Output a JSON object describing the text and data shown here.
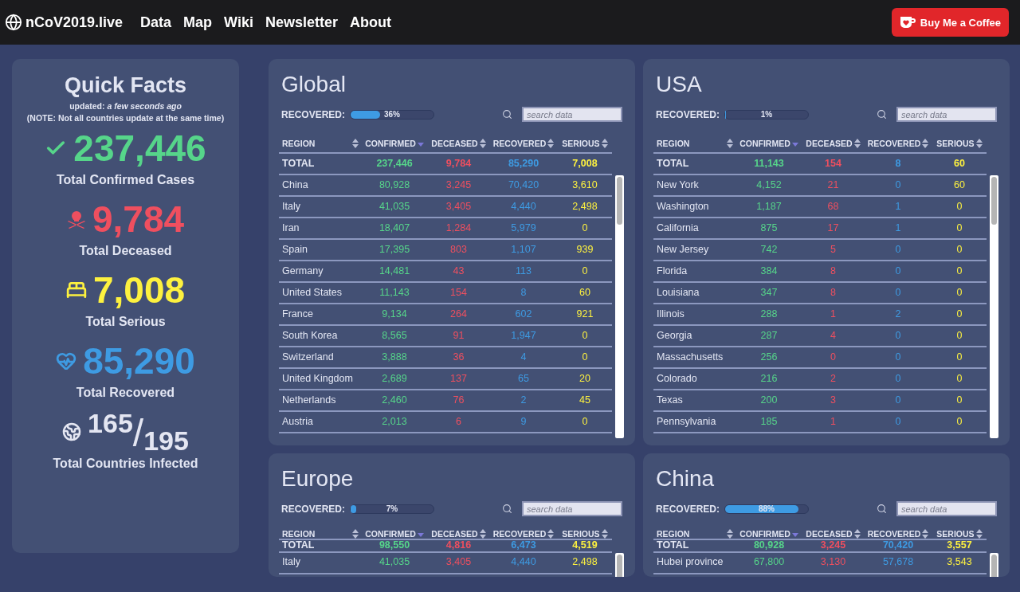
{
  "nav": {
    "brand": "nCoV2019.live",
    "links": [
      "Data",
      "Map",
      "Wiki",
      "Newsletter",
      "About"
    ],
    "donate_button": "Buy Me a Coffee"
  },
  "quick_facts": {
    "title": "Quick Facts",
    "updated_label": "updated:",
    "updated_value": "a few seconds ago",
    "note": "(NOTE: Not all countries update at the same time)",
    "stats": [
      {
        "kind": "confirmed",
        "value": "237,446",
        "label": "Total Confirmed Cases"
      },
      {
        "kind": "deceased",
        "value": "9,784",
        "label": "Total Deceased"
      },
      {
        "kind": "serious",
        "value": "7,008",
        "label": "Total Serious"
      },
      {
        "kind": "recovered",
        "value": "85,290",
        "label": "Total Recovered"
      }
    ],
    "countries": {
      "infected": "165",
      "separator": "/",
      "total": "195",
      "label": "Total Countries Infected"
    }
  },
  "panels": [
    {
      "title": "Global",
      "recovered_label": "RECOVERED:",
      "recovered": {
        "level": 0.36,
        "reading": "36%"
      },
      "search": {
        "placeholder": "search data"
      },
      "columns": [
        {
          "label": "REGION",
          "sorted": false
        },
        {
          "label": "CONFIRMED",
          "sorted": true
        },
        {
          "label": "DECEASED",
          "sorted": false
        },
        {
          "label": "RECOVERED",
          "sorted": false
        },
        {
          "label": "SERIOUS",
          "sorted": false
        }
      ],
      "total": [
        "TOTAL",
        "237,446",
        "9,784",
        "85,290",
        "7,008"
      ],
      "rows": [
        [
          "China",
          "80,928",
          "3,245",
          "70,420",
          "3,610"
        ],
        [
          "Italy",
          "41,035",
          "3,405",
          "4,440",
          "2,498"
        ],
        [
          "Iran",
          "18,407",
          "1,284",
          "5,979",
          "0"
        ],
        [
          "Spain",
          "17,395",
          "803",
          "1,107",
          "939"
        ],
        [
          "Germany",
          "14,481",
          "43",
          "113",
          "0"
        ],
        [
          "United States",
          "11,143",
          "154",
          "8",
          "60"
        ],
        [
          "France",
          "9,134",
          "264",
          "602",
          "921"
        ],
        [
          "South Korea",
          "8,565",
          "91",
          "1,947",
          "0"
        ],
        [
          "Switzerland",
          "3,888",
          "36",
          "4",
          "0"
        ],
        [
          "United Kingdom",
          "2,689",
          "137",
          "65",
          "20"
        ],
        [
          "Netherlands",
          "2,460",
          "76",
          "2",
          "45"
        ],
        [
          "Austria",
          "2,013",
          "6",
          "9",
          "0"
        ]
      ]
    },
    {
      "title": "USA",
      "recovered_label": "RECOVERED:",
      "recovered": {
        "level": 0.01,
        "reading": "1%"
      },
      "search": {
        "placeholder": "search data"
      },
      "columns": [
        {
          "label": "REGION",
          "sorted": false
        },
        {
          "label": "CONFIRMED",
          "sorted": true
        },
        {
          "label": "DECEASED",
          "sorted": false
        },
        {
          "label": "RECOVERED",
          "sorted": false
        },
        {
          "label": "SERIOUS",
          "sorted": false
        }
      ],
      "total": [
        "TOTAL",
        "11,143",
        "154",
        "8",
        "60"
      ],
      "rows": [
        [
          "New York",
          "4,152",
          "21",
          "0",
          "60"
        ],
        [
          "Washington",
          "1,187",
          "68",
          "1",
          "0"
        ],
        [
          "California",
          "875",
          "17",
          "1",
          "0"
        ],
        [
          "New Jersey",
          "742",
          "5",
          "0",
          "0"
        ],
        [
          "Florida",
          "384",
          "8",
          "0",
          "0"
        ],
        [
          "Louisiana",
          "347",
          "8",
          "0",
          "0"
        ],
        [
          "Illinois",
          "288",
          "1",
          "2",
          "0"
        ],
        [
          "Georgia",
          "287",
          "4",
          "0",
          "0"
        ],
        [
          "Massachusetts",
          "256",
          "0",
          "0",
          "0"
        ],
        [
          "Colorado",
          "216",
          "2",
          "0",
          "0"
        ],
        [
          "Texas",
          "200",
          "3",
          "0",
          "0"
        ],
        [
          "Pennsylvania",
          "185",
          "1",
          "0",
          "0"
        ]
      ]
    },
    {
      "title": "Europe",
      "recovered_label": "RECOVERED:",
      "recovered": {
        "level": 0.07,
        "reading": "7%"
      },
      "search": {
        "placeholder": "search data"
      },
      "columns": [
        {
          "label": "REGION",
          "sorted": false
        },
        {
          "label": "CONFIRMED",
          "sorted": true
        },
        {
          "label": "DECEASED",
          "sorted": false
        },
        {
          "label": "RECOVERED",
          "sorted": false
        },
        {
          "label": "SERIOUS",
          "sorted": false
        }
      ],
      "total": [
        "TOTAL",
        "98,550",
        "4,816",
        "6,473",
        "4,519"
      ],
      "rows": [
        [
          "Italy",
          "41,035",
          "3,405",
          "4,440",
          "2,498"
        ]
      ]
    },
    {
      "title": "China",
      "recovered_label": "RECOVERED:",
      "recovered": {
        "level": 0.88,
        "reading": "88%"
      },
      "search": {
        "placeholder": "search data"
      },
      "columns": [
        {
          "label": "REGION",
          "sorted": false
        },
        {
          "label": "CONFIRMED",
          "sorted": true
        },
        {
          "label": "DECEASED",
          "sorted": false
        },
        {
          "label": "RECOVERED",
          "sorted": false
        },
        {
          "label": "SERIOUS",
          "sorted": false
        }
      ],
      "total": [
        "TOTAL",
        "80,928",
        "3,245",
        "70,420",
        "3,557"
      ],
      "rows": [
        [
          "Hubei province",
          "67,800",
          "3,130",
          "57,678",
          "3,543"
        ]
      ]
    }
  ]
}
